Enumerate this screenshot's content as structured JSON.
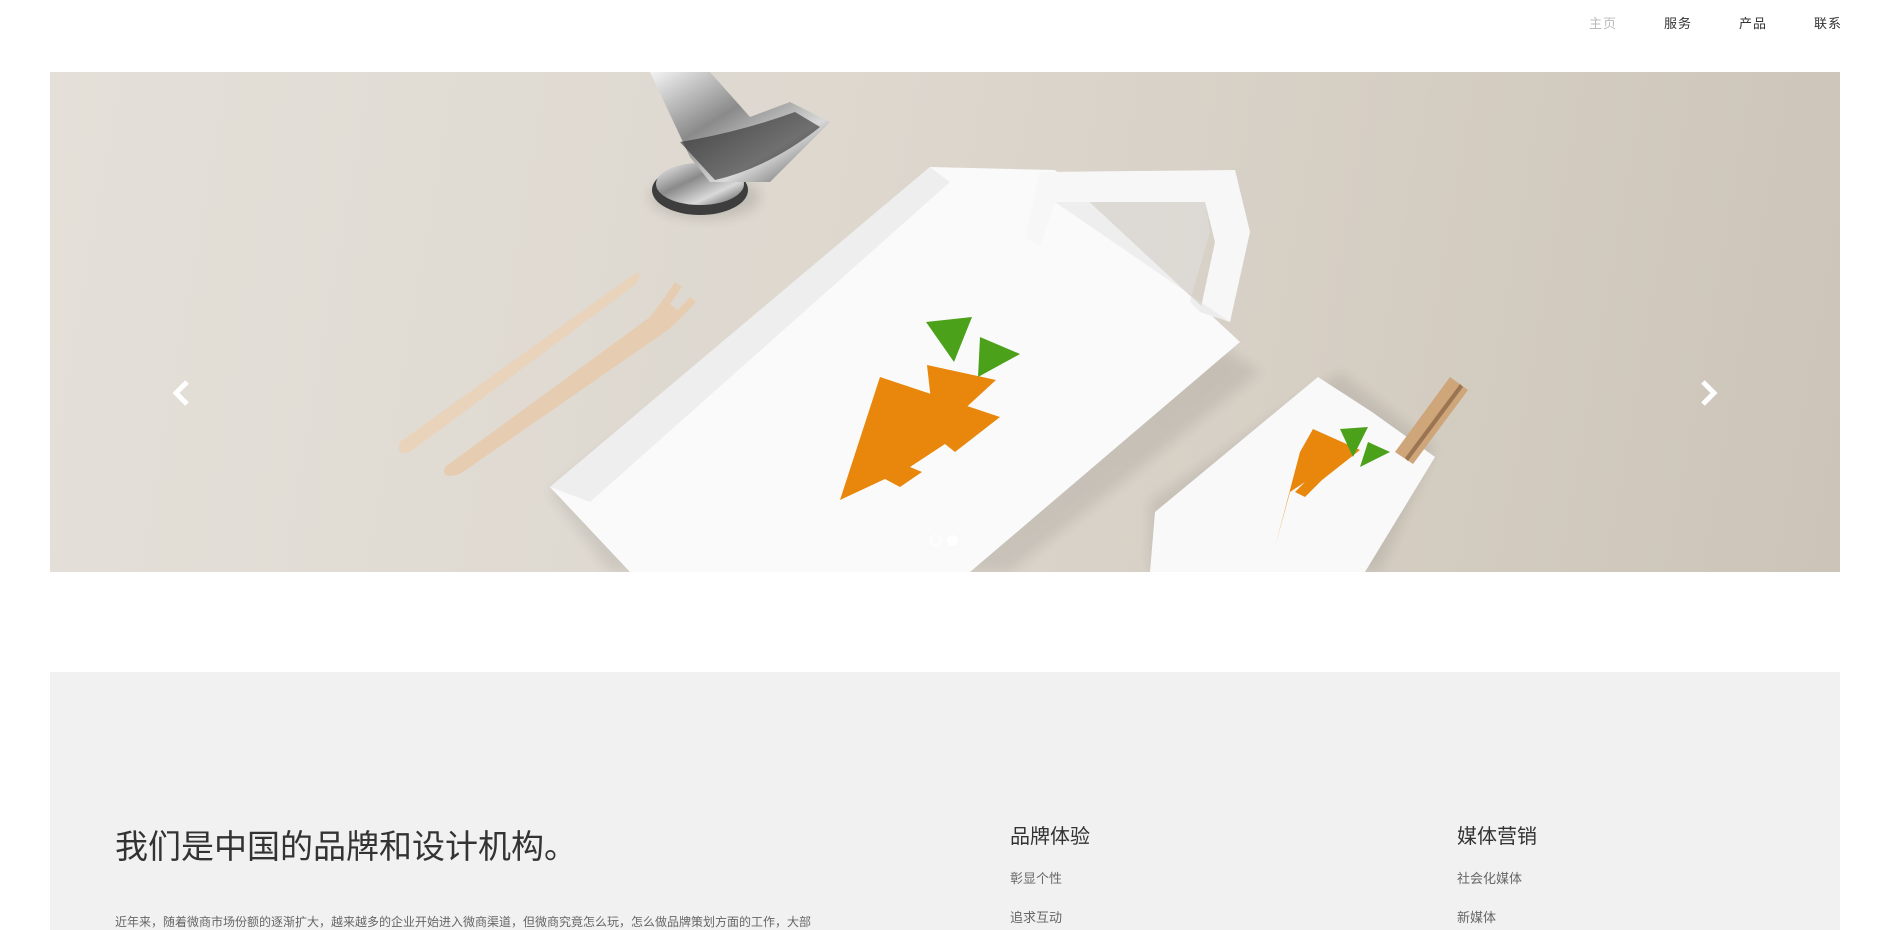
{
  "nav": {
    "items": [
      {
        "label": "主页",
        "active": true
      },
      {
        "label": "服务",
        "active": false
      },
      {
        "label": "产品",
        "active": false
      },
      {
        "label": "联系",
        "active": false
      }
    ]
  },
  "hero": {
    "slide_count": 2,
    "active_slide": 2,
    "colors": {
      "carrot_orange": "#e8870c",
      "leaf_green": "#4ca11a",
      "paper_white": "#ffffff"
    }
  },
  "about": {
    "heading": "我们是中国的品牌和设计机构。",
    "paragraph": "近年来，随着微商市场份额的逐渐扩大，越来越多的企业开始进入微商渠道，但微商究竟怎么玩，怎么做品牌策划方面的工作，大部",
    "columns": [
      {
        "title": "品牌体验",
        "items": [
          "彰显个性",
          "追求互动"
        ]
      },
      {
        "title": "媒体营销",
        "items": [
          "社会化媒体",
          "新媒体"
        ]
      }
    ]
  }
}
